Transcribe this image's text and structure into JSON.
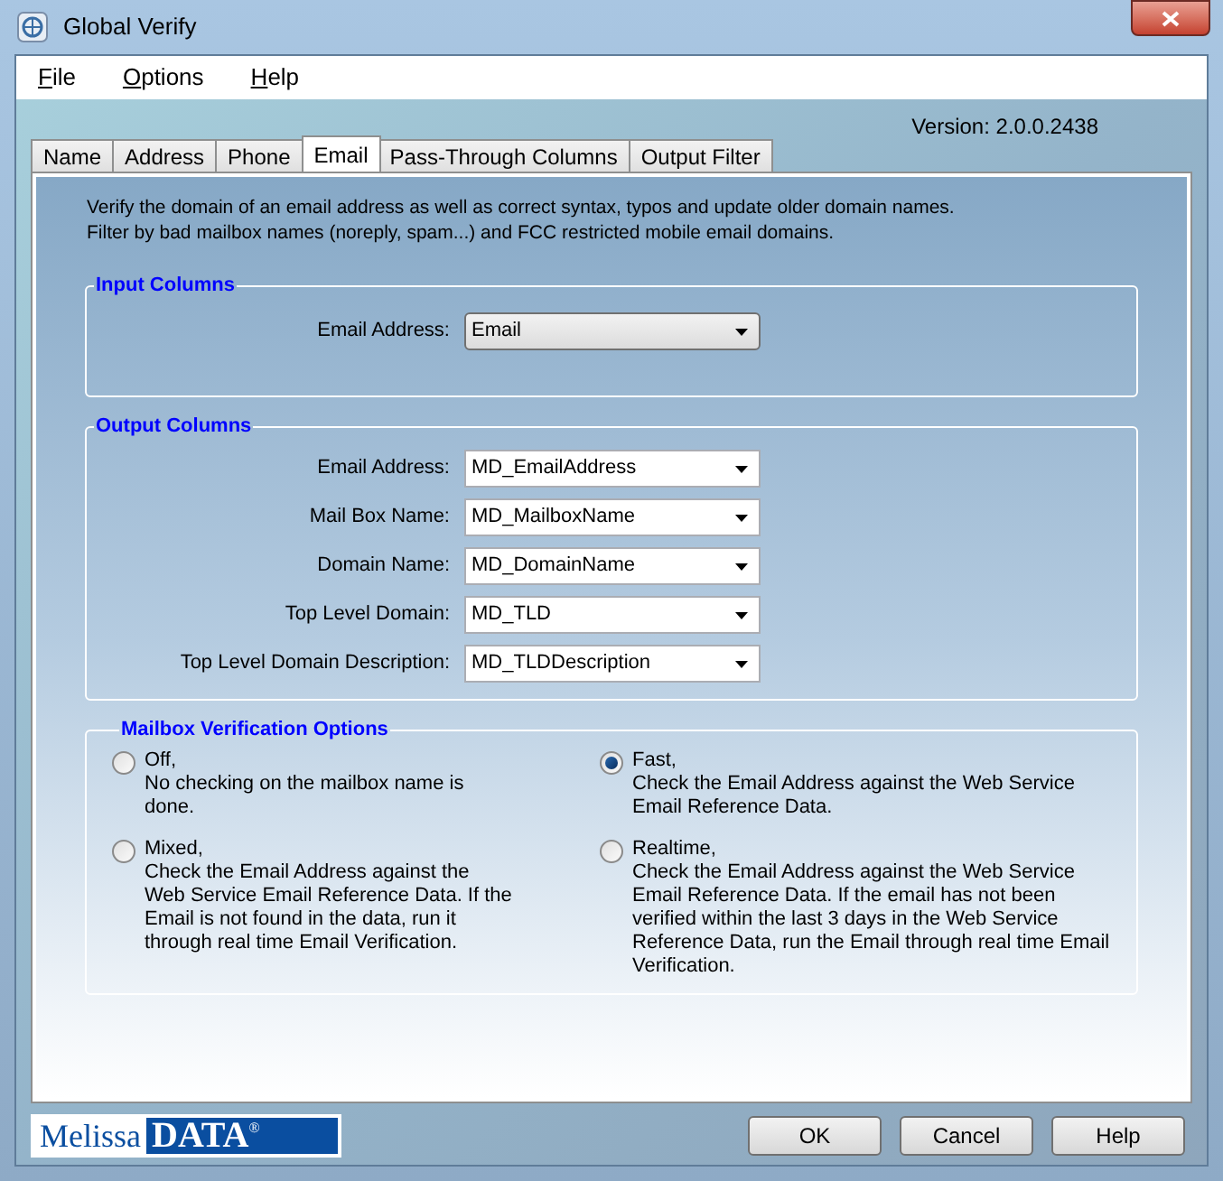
{
  "window": {
    "title": "Global Verify"
  },
  "menu": [
    "File",
    "Options",
    "Help"
  ],
  "version": "Version: 2.0.0.2438",
  "tabs": [
    {
      "label": "Name",
      "selected": false
    },
    {
      "label": "Address",
      "selected": false
    },
    {
      "label": "Phone",
      "selected": false
    },
    {
      "label": "Email",
      "selected": true
    },
    {
      "label": "Pass-Through Columns",
      "selected": false
    },
    {
      "label": "Output Filter",
      "selected": false
    }
  ],
  "description": [
    "Verify the domain of an email address as well as correct syntax, typos and update older domain names.",
    "Filter by bad mailbox names (noreply, spam...) and FCC restricted mobile email domains."
  ],
  "input_columns": {
    "title": "Input Columns",
    "fields": [
      {
        "label": "Email Address:",
        "value": "Email",
        "kind": "list"
      }
    ]
  },
  "output_columns": {
    "title": "Output Columns",
    "fields": [
      {
        "label": "Email Address:",
        "value": "MD_EmailAddress",
        "kind": "combo"
      },
      {
        "label": "Mail Box Name:",
        "value": "MD_MailboxName",
        "kind": "combo"
      },
      {
        "label": "Domain Name:",
        "value": "MD_DomainName",
        "kind": "combo"
      },
      {
        "label": "Top Level Domain:",
        "value": "MD_TLD",
        "kind": "combo"
      },
      {
        "label": "Top Level Domain Description:",
        "value": "MD_TLDDescription",
        "kind": "combo"
      }
    ]
  },
  "mailbox_options": {
    "title": "Mailbox Verification Options",
    "options": [
      {
        "label": "Off,",
        "description": "No checking on the mailbox name is done.",
        "selected": false
      },
      {
        "label": "Fast,",
        "description": "Check the Email Address against the Web Service Email Reference Data.",
        "selected": true
      },
      {
        "label": "Mixed,",
        "description": "Check the Email Address against the Web Service Email Reference Data. If the Email is not found in the data, run it through real time Email Verification.",
        "selected": false
      },
      {
        "label": "Realtime,",
        "description": "Check the Email Address against the Web Service Email Reference Data. If the email has not been verified within the last 3 days in the Web Service Reference Data, run the Email through real time Email Verification.",
        "selected": false
      }
    ]
  },
  "logo": {
    "left": "Melissa",
    "right": "DATA",
    "mark": "®"
  },
  "buttons": [
    "OK",
    "Cancel",
    "Help"
  ]
}
